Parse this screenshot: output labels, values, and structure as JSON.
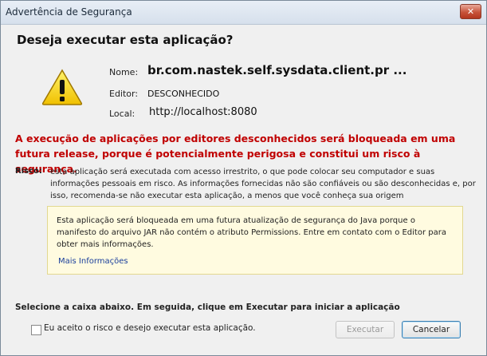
{
  "window": {
    "title": "Advertência de Segurança",
    "close_label": "✕"
  },
  "dialog": {
    "heading": "Deseja executar esta aplicação?",
    "warning_icon": "warning-triangle-icon",
    "name_label": "Nome:",
    "name_value": "br.com.nastek.self.sysdata.client.pr ...",
    "editor_label": "Editor:",
    "editor_value": "DESCONHECIDO",
    "local_label": "Local:",
    "local_value": "http://localhost:8080",
    "red_warning": "A execução de aplicações por editores desconhecidos será bloqueada em uma futura release, porque é potencialmente perigosa e constitui um risco à segurança.",
    "risk_label": "Risco:",
    "risk_text": "esta aplicação será executada com acesso irrestrito, o que pode colocar seu computador e suas informações pessoais em risco. As informações fornecidas não são confiáveis ou são desconhecidas e, por isso, recomenda-se não executar esta aplicação, a menos que você conheça sua origem",
    "note_text": "Esta aplicação será bloqueada em uma futura atualização de segurança do Java porque o manifesto do arquivo JAR não contém o atributo Permissions. Entre em contato com o Editor para obter mais informações.",
    "more_info_link": "Mais Informações",
    "instruction": "Selecione a caixa abaixo. Em seguida, clique em Executar para iniciar a aplicação",
    "checkbox_label": "Eu aceito o risco e desejo executar esta aplicação.",
    "checkbox_checked": false,
    "run_button": "Executar",
    "cancel_button": "Cancelar"
  },
  "colors": {
    "warning_red": "#c00000",
    "note_bg": "#fffbe0",
    "link_blue": "#1a3f9c",
    "title_bg": "#d6e0ec"
  }
}
